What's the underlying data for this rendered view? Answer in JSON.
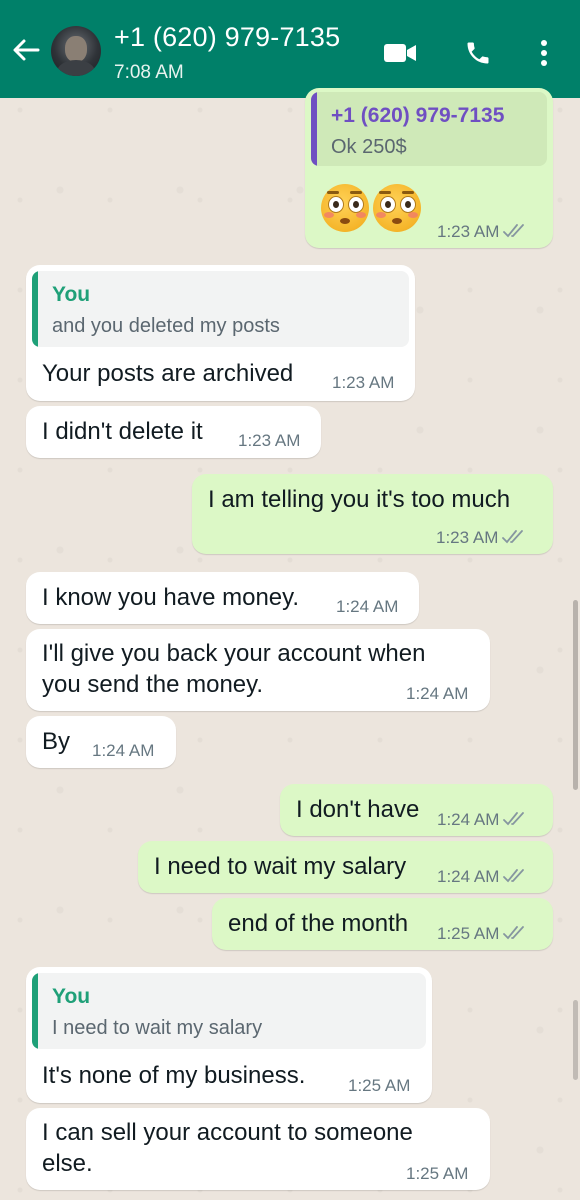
{
  "header": {
    "contact_name": "+1 (620) 979-7135",
    "status": "7:08 AM",
    "bg_color": "#008069"
  },
  "messages": [
    {
      "side": "out",
      "quote": {
        "name": "+1 (620) 979-7135",
        "text": "Ok 250$"
      },
      "emoji": [
        "flushed-face",
        "flushed-face"
      ],
      "time": "1:23 AM",
      "ticks": "double-check-icon"
    },
    {
      "side": "in",
      "quote": {
        "name": "You",
        "text": "and you deleted my posts"
      },
      "text": "Your posts are archived",
      "time": "1:23 AM"
    },
    {
      "side": "in",
      "text": "I didn't delete it",
      "time": "1:23 AM"
    },
    {
      "side": "out",
      "text": "I am telling you it's too much",
      "time": "1:23 AM",
      "ticks": "double-check-icon"
    },
    {
      "side": "in",
      "text": "I know you have money.",
      "time": "1:24 AM"
    },
    {
      "side": "in",
      "text_lines": [
        "I'll give you back your account when",
        "you send the money."
      ],
      "time": "1:24 AM"
    },
    {
      "side": "in",
      "text": "By",
      "time": "1:24 AM"
    },
    {
      "side": "out",
      "text": "I don't have",
      "time": "1:24 AM",
      "ticks": "double-check-icon"
    },
    {
      "side": "out",
      "text": "I need to wait my salary",
      "time": "1:24 AM",
      "ticks": "double-check-icon"
    },
    {
      "side": "out",
      "text": "end of the month",
      "time": "1:25 AM",
      "ticks": "double-check-icon"
    },
    {
      "side": "in",
      "quote": {
        "name": "You",
        "text": "I need to wait my salary"
      },
      "text": "It's none of my business.",
      "time": "1:25 AM"
    },
    {
      "side": "in",
      "text_lines": [
        "I can sell your account to someone",
        "else."
      ],
      "time": "1:25 AM"
    }
  ],
  "colors": {
    "incoming_bubble": "#ffffff",
    "outgoing_bubble": "#dcf8c6",
    "quote_you": "#1fa078",
    "quote_contact": "#6f4fc2",
    "chat_background": "#ece5dd"
  }
}
